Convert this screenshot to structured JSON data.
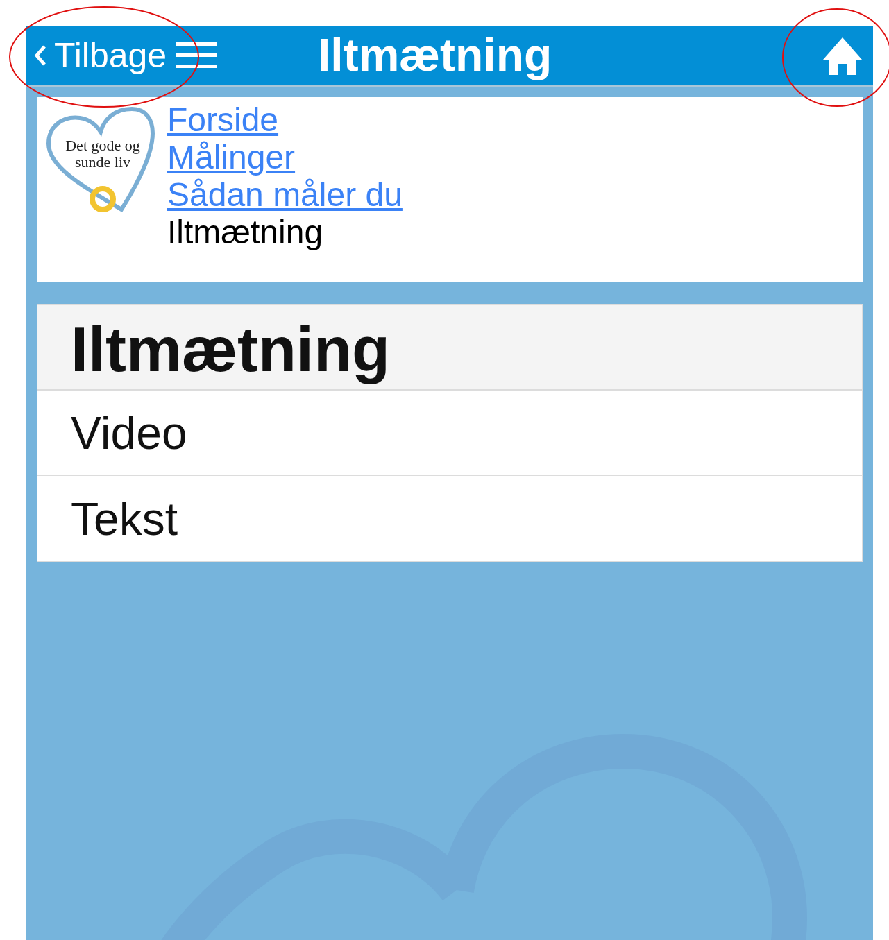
{
  "header": {
    "back_label": "Tilbage",
    "title": "Iltmætning"
  },
  "logo": {
    "text": "Det gode og sunde liv"
  },
  "breadcrumb": [
    {
      "label": "Forside",
      "link": true
    },
    {
      "label": "Målinger",
      "link": true
    },
    {
      "label": "Sådan måler du",
      "link": true
    },
    {
      "label": "Iltmætning",
      "link": false
    }
  ],
  "section": {
    "title": "Iltmætning",
    "items": [
      "Video",
      "Tekst"
    ]
  }
}
